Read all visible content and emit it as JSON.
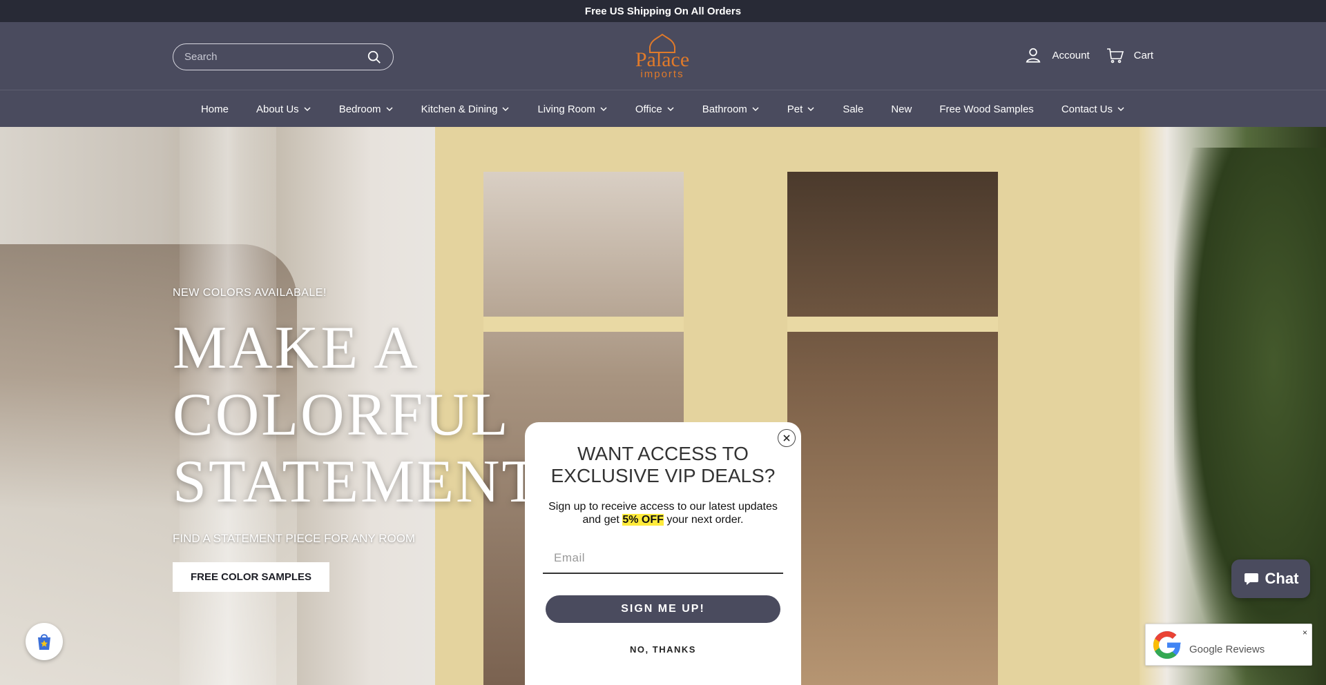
{
  "announcement": "Free US Shipping On All Orders",
  "header": {
    "search_placeholder": "Search",
    "logo_text": "Palace",
    "logo_subtext": "imports",
    "account_label": "Account",
    "cart_label": "Cart"
  },
  "nav": {
    "items": [
      {
        "label": "Home"
      },
      {
        "label": "About Us"
      },
      {
        "label": "Bedroom"
      },
      {
        "label": "Kitchen & Dining"
      },
      {
        "label": "Living Room"
      },
      {
        "label": "Office"
      },
      {
        "label": "Bathroom"
      },
      {
        "label": "Pet"
      },
      {
        "label": "Sale"
      },
      {
        "label": "New"
      },
      {
        "label": "Free Wood Samples"
      },
      {
        "label": "Contact Us"
      }
    ]
  },
  "hero": {
    "kicker": "NEW COLORS AVAILABALE!",
    "title_line1": "MAKE A",
    "title_line2": "COLORFUL",
    "title_line3": "STATEMENT",
    "subtitle": "FIND A STATEMENT PIECE FOR ANY ROOM",
    "button_label": "FREE COLOR SAMPLES"
  },
  "popup": {
    "title_line1": "WANT ACCESS TO",
    "title_line2": "EXCLUSIVE VIP DEALS?",
    "desc_before": "Sign up to receive access to our latest updates and get ",
    "desc_highlight": "5% OFF",
    "desc_after": " your next order.",
    "email_placeholder": "Email",
    "submit_label": "SIGN ME UP!",
    "decline_label": "NO, THANKS"
  },
  "chat": {
    "label": "Chat"
  },
  "google_reviews": {
    "label": "Google Reviews",
    "close": "×"
  },
  "colors": {
    "header_bg": "#4a4b5e",
    "announce_bg": "#282a36",
    "logo_orange": "#e07a2a",
    "highlight_yellow": "#ffeb3b"
  }
}
